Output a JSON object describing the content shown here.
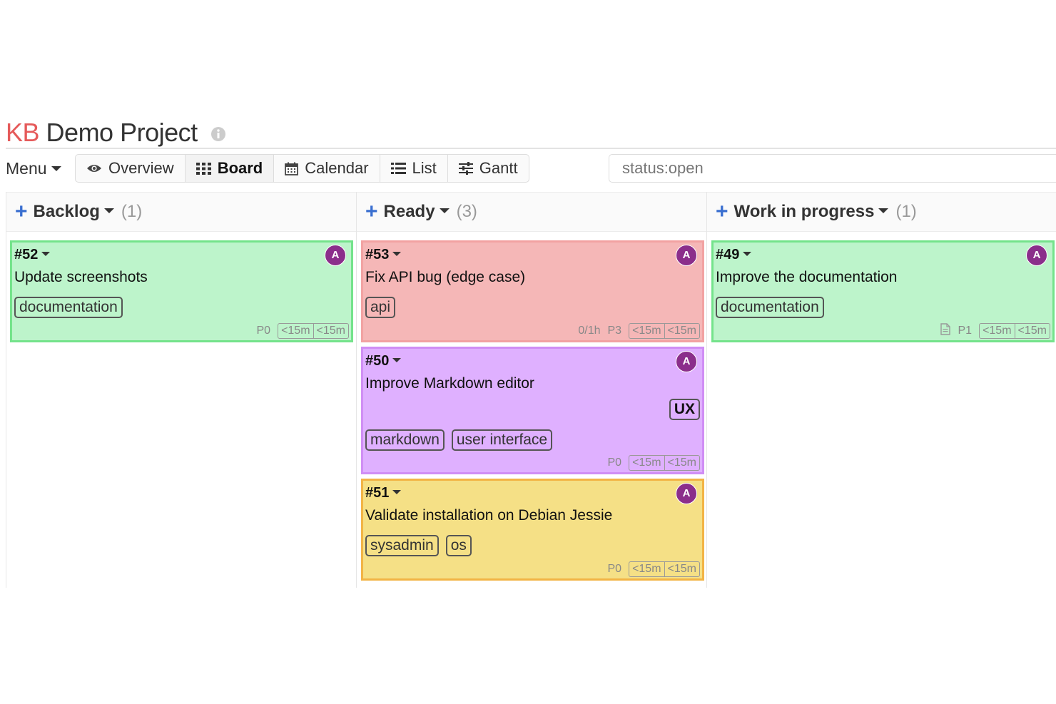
{
  "project": {
    "logo": "KB",
    "name": "Demo Project"
  },
  "nav": {
    "menu_label": "Menu",
    "views": [
      {
        "label": "Overview",
        "icon": "eye-icon",
        "active": false
      },
      {
        "label": "Board",
        "icon": "board-grid-icon",
        "active": true
      },
      {
        "label": "Calendar",
        "icon": "calendar-icon",
        "active": false
      },
      {
        "label": "List",
        "icon": "list-icon",
        "active": false
      },
      {
        "label": "Gantt",
        "icon": "sliders-icon",
        "active": false
      }
    ],
    "search_value": "status:open"
  },
  "columns": [
    {
      "title": "Backlog",
      "count": "(1)",
      "cards": [
        {
          "id": "#52",
          "avatar": "A",
          "title": "Update screenshots",
          "tags": [
            "documentation"
          ],
          "priority": "P0",
          "time_estimated": "<15m",
          "time_spent": "<15m",
          "color": "green"
        }
      ]
    },
    {
      "title": "Ready",
      "count": "(3)",
      "cards": [
        {
          "id": "#53",
          "avatar": "A",
          "title": "Fix API bug (edge case)",
          "tags": [
            "api"
          ],
          "subtasks": "0/1h",
          "priority": "P3",
          "time_estimated": "<15m",
          "time_spent": "<15m",
          "color": "red"
        },
        {
          "id": "#50",
          "avatar": "A",
          "title": "Improve Markdown editor",
          "category": "UX",
          "tags": [
            "markdown",
            "user interface"
          ],
          "priority": "P0",
          "time_estimated": "<15m",
          "time_spent": "<15m",
          "color": "purple"
        },
        {
          "id": "#51",
          "avatar": "A",
          "title": "Validate installation on Debian Jessie",
          "tags": [
            "sysadmin",
            "os"
          ],
          "priority": "P0",
          "time_estimated": "<15m",
          "time_spent": "<15m",
          "color": "yellow"
        }
      ]
    },
    {
      "title": "Work in progress",
      "count": "(1)",
      "cards": [
        {
          "id": "#49",
          "avatar": "A",
          "title": "Improve the documentation",
          "tags": [
            "documentation"
          ],
          "has_document": true,
          "priority": "P1",
          "time_estimated": "<15m",
          "time_spent": "<15m",
          "color": "green"
        }
      ]
    }
  ],
  "colors": {
    "logo": "#e55a5a",
    "plus": "#3a6fd0",
    "avatar": "#8b2e8b",
    "green_card": "#bdf4cb",
    "red_card": "#f5b7b7",
    "purple_card": "#dfb0ff",
    "yellow_card": "#f5e086"
  }
}
